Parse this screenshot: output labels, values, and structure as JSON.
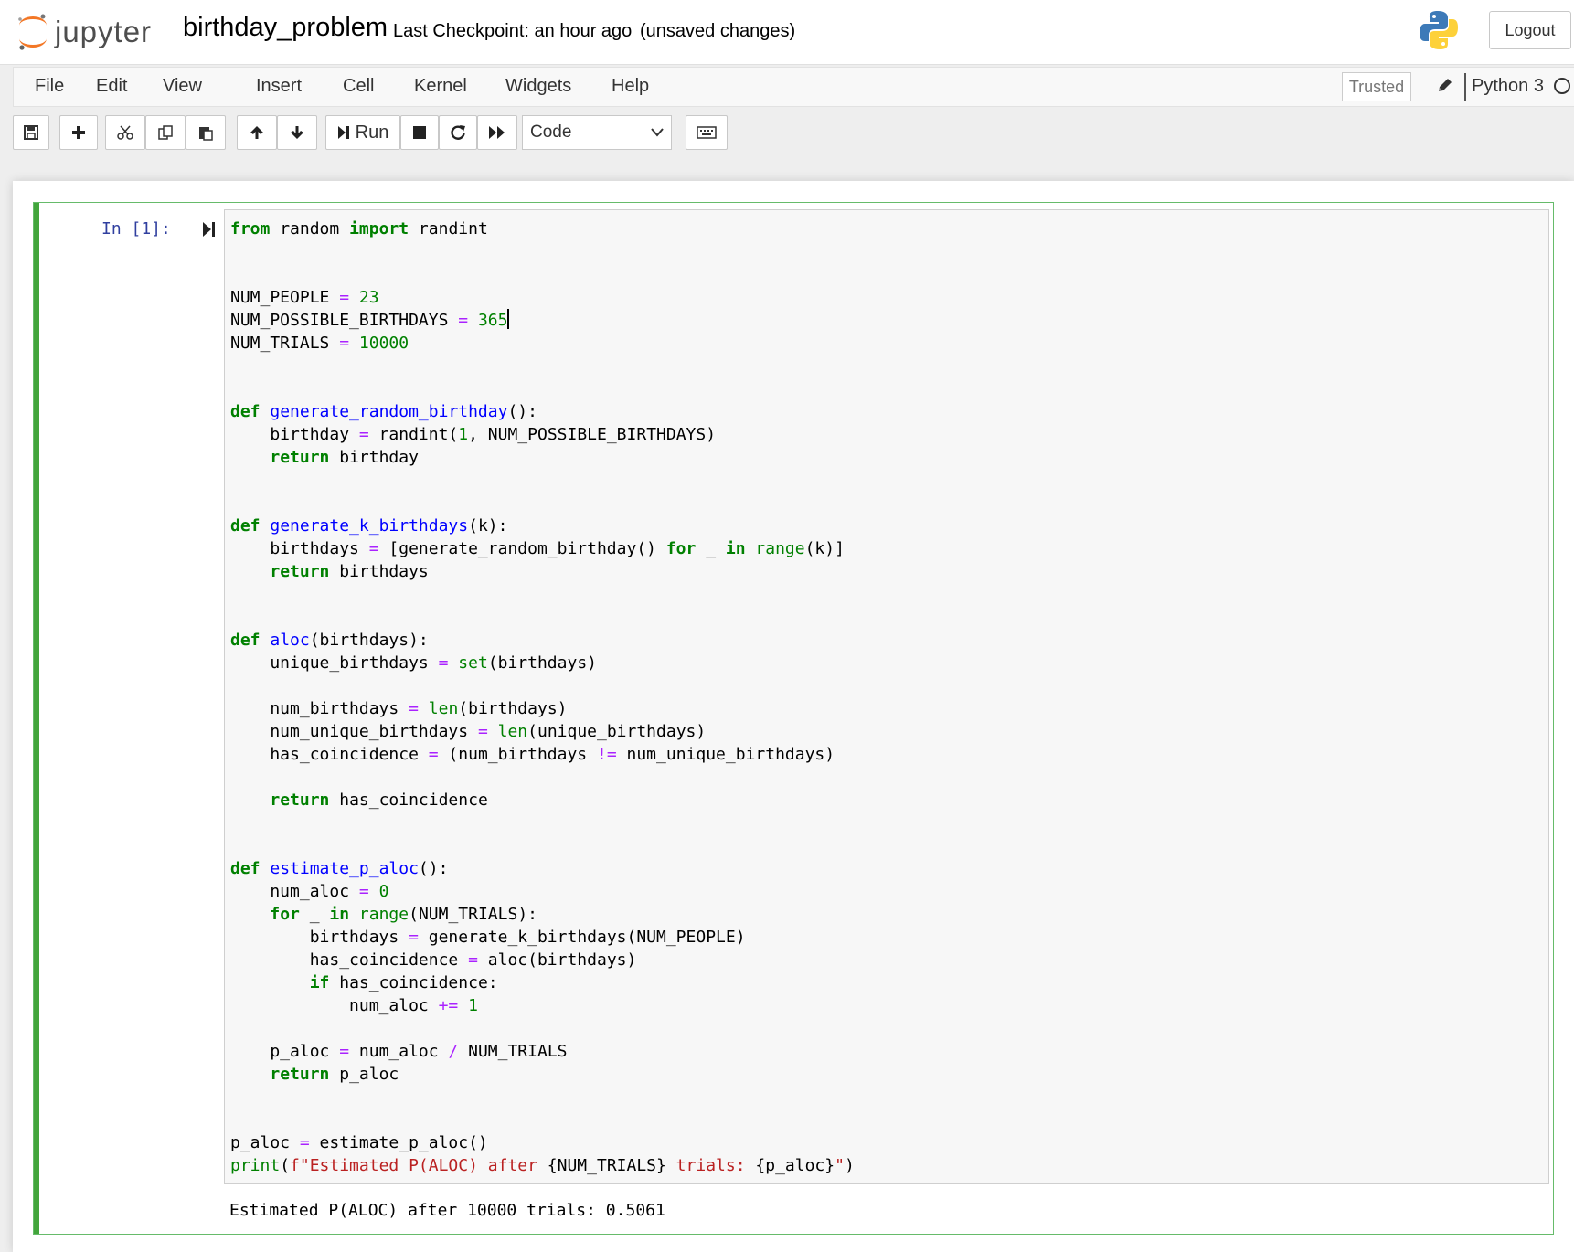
{
  "header": {
    "logo_text": "jupyter",
    "notebook_name": "birthday_problem",
    "checkpoint": "Last Checkpoint: an hour ago",
    "unsaved": "(unsaved changes)",
    "logout_label": "Logout"
  },
  "menubar": {
    "items": [
      "File",
      "Edit",
      "View",
      "Insert",
      "Cell",
      "Kernel",
      "Widgets",
      "Help"
    ],
    "trusted_label": "Trusted",
    "kernel_name": "Python 3"
  },
  "toolbar": {
    "run_label": "Run",
    "cell_type": "Code",
    "icons": [
      "save-icon",
      "plus-icon",
      "cut-icon",
      "copy-icon",
      "paste-icon",
      "arrow-up-icon",
      "arrow-down-icon",
      "run-icon",
      "stop-icon",
      "restart-icon",
      "fast-forward-icon",
      "keyboard-icon"
    ]
  },
  "cell": {
    "prompt": "In [1]:",
    "code_lines": [
      "from random import randint",
      "",
      "",
      "NUM_PEOPLE = 23",
      "NUM_POSSIBLE_BIRTHDAYS = 365",
      "NUM_TRIALS = 10000",
      "",
      "",
      "def generate_random_birthday():",
      "    birthday = randint(1, NUM_POSSIBLE_BIRTHDAYS)",
      "    return birthday",
      "",
      "",
      "def generate_k_birthdays(k):",
      "    birthdays = [generate_random_birthday() for _ in range(k)]",
      "    return birthdays",
      "",
      "",
      "def aloc(birthdays):",
      "    unique_birthdays = set(birthdays)",
      "",
      "    num_birthdays = len(birthdays)",
      "    num_unique_birthdays = len(unique_birthdays)",
      "    has_coincidence = (num_birthdays != num_unique_birthdays)",
      "",
      "    return has_coincidence",
      "",
      "",
      "def estimate_p_aloc():",
      "    num_aloc = 0",
      "    for _ in range(NUM_TRIALS):",
      "        birthdays = generate_k_birthdays(NUM_PEOPLE)",
      "        has_coincidence = aloc(birthdays)",
      "        if has_coincidence:",
      "            num_aloc += 1",
      "",
      "    p_aloc = num_aloc / NUM_TRIALS",
      "    return p_aloc",
      "",
      "",
      "p_aloc = estimate_p_aloc()",
      "print(f\"Estimated P(ALOC) after {NUM_TRIALS} trials: {p_aloc}\")"
    ],
    "output": "Estimated P(ALOC) after 10000 trials: 0.5061"
  },
  "colors": {
    "keyword": "#008000",
    "function": "#0000ff",
    "operator": "#aa22ff",
    "string": "#ba2121",
    "prompt": "#303f9f",
    "cell_border": "#42a53b"
  }
}
